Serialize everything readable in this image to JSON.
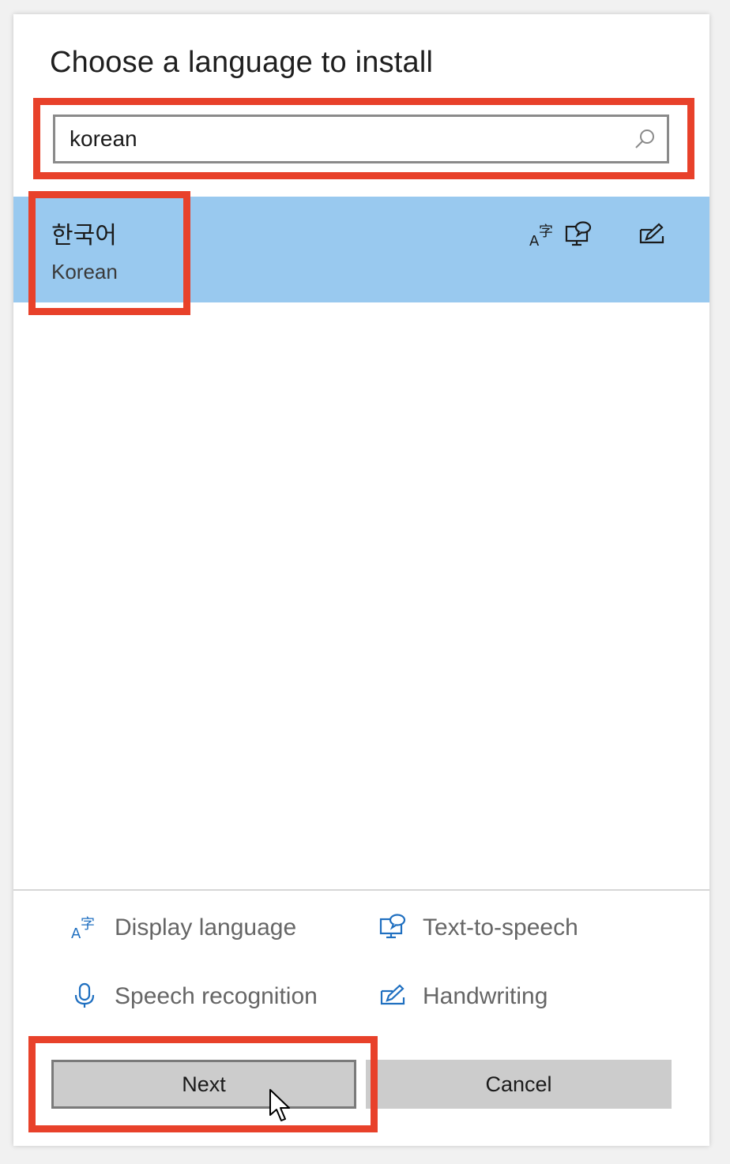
{
  "dialog": {
    "title": "Choose a language to install"
  },
  "search": {
    "value": "korean",
    "icon": "search-icon"
  },
  "results": [
    {
      "native_name": "한국어",
      "english_name": "Korean",
      "features": [
        "display-language-icon",
        "text-to-speech-icon",
        "handwriting-icon"
      ],
      "selected": true
    }
  ],
  "legend": {
    "display_language": "Display language",
    "text_to_speech": "Text-to-speech",
    "speech_recognition": "Speech recognition",
    "handwriting": "Handwriting"
  },
  "buttons": {
    "next": "Next",
    "cancel": "Cancel"
  },
  "colors": {
    "selected_row": "#99c9ef",
    "icon_blue": "#1f6fc0",
    "highlight_red": "#e8412a",
    "button_gray": "#cccccc"
  }
}
